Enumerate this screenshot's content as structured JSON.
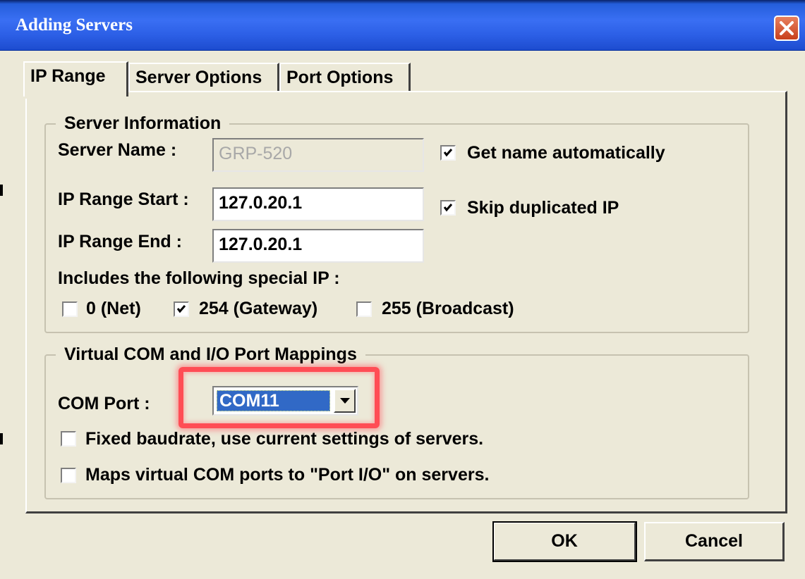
{
  "window": {
    "title": "Adding Servers"
  },
  "tabs": [
    {
      "label": "IP Range",
      "active": true
    },
    {
      "label": "Server Options",
      "active": false
    },
    {
      "label": "Port Options",
      "active": false
    }
  ],
  "server_information": {
    "legend": "Server Information",
    "server_name": {
      "label": "Server Name :",
      "value": "GRP-520",
      "disabled": true
    },
    "get_name_automatically": {
      "label": "Get name automatically",
      "checked": true
    },
    "ip_range_start": {
      "label": "IP Range Start :",
      "value": "127.0.20.1"
    },
    "skip_duplicated_ip": {
      "label": "Skip duplicated IP",
      "checked": true
    },
    "ip_range_end": {
      "label": "IP Range End :",
      "value": "127.0.20.1"
    },
    "special_ip_label": "Includes the following special IP :",
    "special_ips": [
      {
        "label": "0 (Net)",
        "checked": false
      },
      {
        "label": "254 (Gateway)",
        "checked": true
      },
      {
        "label": "255 (Broadcast)",
        "checked": false
      }
    ]
  },
  "port_mappings": {
    "legend": "Virtual COM and I/O Port Mappings",
    "com_port": {
      "label": "COM Port :",
      "value": "COM11"
    },
    "fixed_baudrate": {
      "label": "Fixed baudrate, use current settings of servers.",
      "checked": false
    },
    "map_port_io": {
      "label": "Maps virtual COM ports to \"Port I/O\" on servers.",
      "checked": false
    }
  },
  "buttons": {
    "ok": "OK",
    "cancel": "Cancel"
  },
  "colors": {
    "title_bar": "#2c5fe6",
    "dialog_bg": "#ece9d8",
    "selection": "#3169c6",
    "highlight_box": "#ff4d55"
  },
  "icons": {
    "close": "close-icon",
    "dropdown": "chevron-down-icon",
    "check": "check-icon"
  }
}
